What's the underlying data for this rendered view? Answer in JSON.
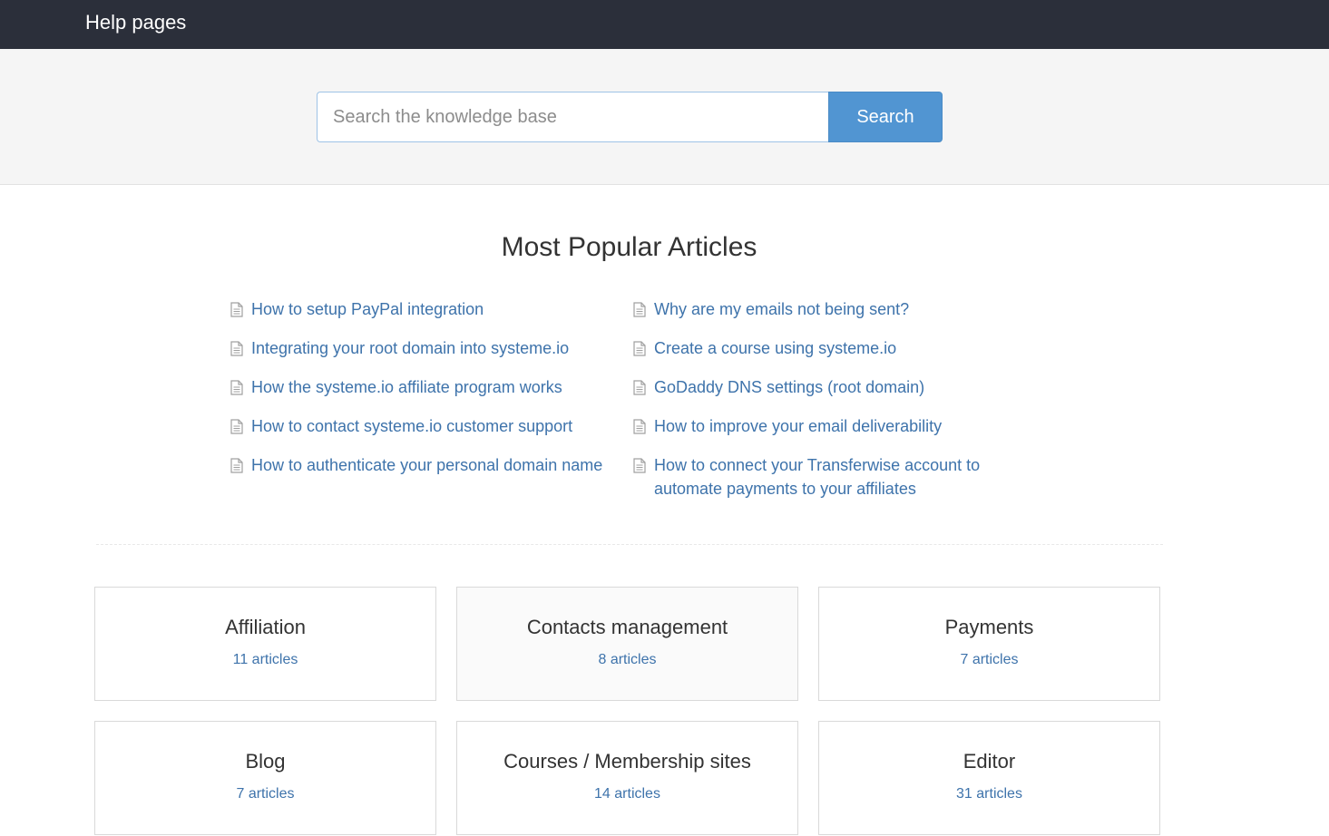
{
  "header": {
    "brand": "Help pages"
  },
  "search": {
    "placeholder": "Search the knowledge base",
    "button_label": "Search"
  },
  "popular": {
    "title": "Most Popular Articles",
    "left": [
      "How to setup PayPal integration",
      "Integrating your root domain into systeme.io",
      "How the systeme.io affiliate program works",
      "How to contact systeme.io customer support",
      "How to authenticate your personal domain name"
    ],
    "right": [
      "Why are my emails not being sent?",
      "Create a course using systeme.io",
      "GoDaddy DNS settings (root domain)",
      "How to improve your email deliverability",
      "How to connect your Transferwise account to automate payments to your affiliates"
    ]
  },
  "categories": [
    {
      "name": "Affiliation",
      "count": "11 articles"
    },
    {
      "name": "Contacts management",
      "count": "8 articles"
    },
    {
      "name": "Payments",
      "count": "7 articles"
    },
    {
      "name": "Blog",
      "count": "7 articles"
    },
    {
      "name": "Courses / Membership sites",
      "count": "14 articles"
    },
    {
      "name": "Editor",
      "count": "31 articles"
    }
  ],
  "colors": {
    "topbar": "#2b2f3a",
    "accent": "#5195d2",
    "link": "#3e73ab"
  }
}
